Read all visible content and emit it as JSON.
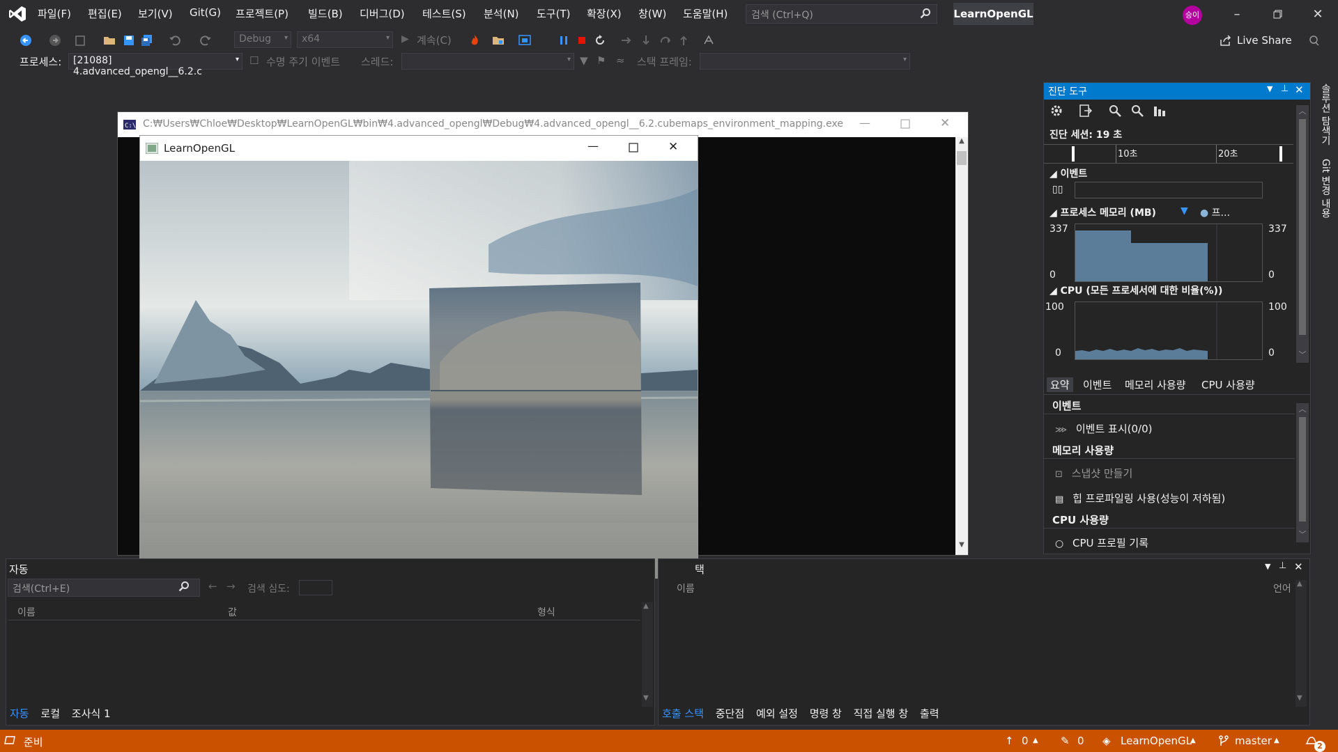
{
  "menubar": {
    "items": [
      "파일(F)",
      "편집(E)",
      "보기(V)",
      "Git(G)",
      "프로젝트(P)",
      "빌드(B)",
      "디버그(D)",
      "테스트(S)",
      "분석(N)",
      "도구(T)",
      "확장(X)",
      "창(W)",
      "도움말(H)"
    ],
    "search_placeholder": "검색 (Ctrl+Q)",
    "solution_name": "LearnOpenGL",
    "avatar_initials": "승이",
    "accent": "#007acc"
  },
  "toolbar": {
    "config": "Debug",
    "platform": "x64",
    "continue_label": "계속(C)",
    "live_share": "Live Share"
  },
  "toolbar2": {
    "process_label": "프로세스:",
    "process_value": "[21088] 4.advanced_opengl__6.2.c",
    "lifecycle_label": "수명 주기 이벤트",
    "thread_label": "스레드:",
    "stackframe_label": "스택 프레임:"
  },
  "console": {
    "title": "C:₩Users₩Chloe₩Desktop₩LearnOpenGL₩bin₩4.advanced_opengl₩Debug₩4.advanced_opengl__6.2.cubemaps_environment_mapping.exe"
  },
  "glwindow": {
    "title": "LearnOpenGL"
  },
  "diagnostics": {
    "title": "진단 도구",
    "session": "진단 세션: 19 초",
    "tick_10": "10초",
    "tick_20": "20초",
    "events_header": "이벤트",
    "memory_header": "프로세스 메모리 (MB)",
    "memory_legend": "프...",
    "mem_max": "337",
    "mem_min": "0",
    "cpu_header": "CPU (모든 프로세서에 대한 비율(%))",
    "cpu_max": "100",
    "cpu_min": "0",
    "tabs": [
      "요약",
      "이벤트",
      "메모리 사용량",
      "CPU 사용량"
    ],
    "summary": {
      "events_title": "이벤트",
      "events_show": "이벤트 표시(0/0)",
      "memory_title": "메모리 사용량",
      "snapshot": "스냅샷 만들기",
      "heap_profiling": "힙 프로파일링 사용(성능이 저하됨)",
      "cpu_title": "CPU 사용량",
      "cpu_record": "CPU 프로필 기록"
    }
  },
  "auto_panel": {
    "title": "자동",
    "search_placeholder": "검색(Ctrl+E)",
    "search_depth": "검색 심도:",
    "columns": [
      "이름",
      "값",
      "형식"
    ],
    "tabs": [
      "자동",
      "로컬",
      "조사식 1"
    ]
  },
  "call_panel": {
    "title_fragment": "택",
    "columns": [
      "이름",
      "언어"
    ],
    "tabs": [
      "호출 스택",
      "중단점",
      "예외 설정",
      "명령 창",
      "직접 실행 창",
      "출력"
    ]
  },
  "statusbar": {
    "ready": "준비",
    "up_count": "0",
    "edit_count": "0",
    "repo": "LearnOpenGL",
    "branch": "master",
    "notifications": "2",
    "color": "#ca5100"
  },
  "right_rail": {
    "items": [
      "솔루션 탐색기",
      "Git 변경 내용"
    ]
  }
}
